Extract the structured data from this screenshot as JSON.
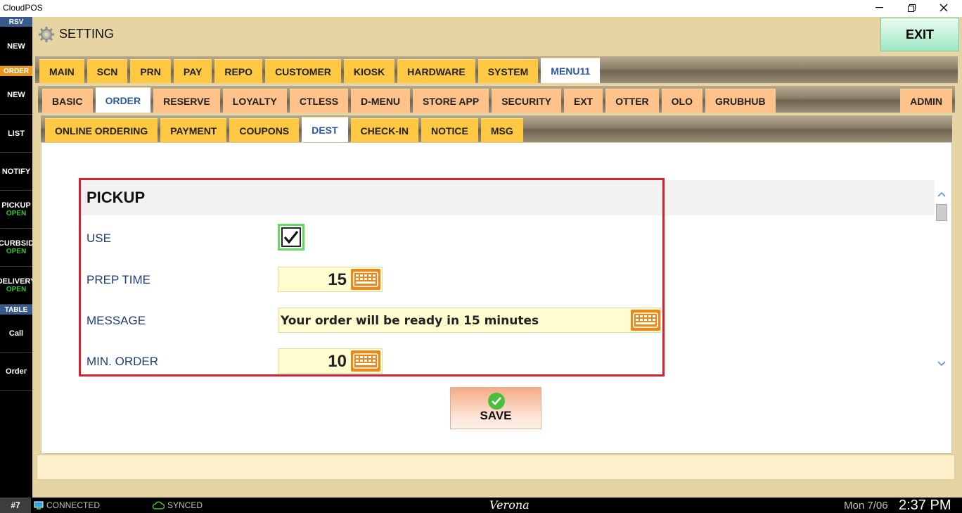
{
  "window": {
    "title": "CloudPOS",
    "minimize_icon": "minimize-icon",
    "maximize_icon": "restore-icon",
    "close_icon": "close-icon"
  },
  "sidebar": {
    "sections": [
      {
        "header": "RSV",
        "header_color": "#3a5a8c",
        "items": [
          {
            "label": "NEW",
            "sub": ""
          }
        ]
      },
      {
        "header": "ORDER",
        "header_color": "#e8951d",
        "items": [
          {
            "label": "NEW",
            "sub": ""
          },
          {
            "label": "LIST",
            "sub": ""
          },
          {
            "label": "NOTIFY",
            "sub": ""
          },
          {
            "label": "PICKUP",
            "sub": "OPEN"
          },
          {
            "label": "CURBSID",
            "sub": "OPEN"
          },
          {
            "label": "DELIVERY",
            "sub": "OPEN"
          }
        ]
      },
      {
        "header": "TABLE",
        "header_color": "#3a5a8c",
        "items": [
          {
            "label": "Call",
            "sub": ""
          },
          {
            "label": "Order",
            "sub": ""
          }
        ]
      }
    ]
  },
  "header": {
    "title": "SETTING",
    "icon": "gear-icon",
    "exit_label": "EXIT"
  },
  "tabs_level1": {
    "active": "MENU11",
    "items": [
      "MAIN",
      "SCN",
      "PRN",
      "PAY",
      "REPO",
      "CUSTOMER",
      "KIOSK",
      "HARDWARE",
      "SYSTEM",
      "MENU11"
    ]
  },
  "tabs_level2": {
    "active": "ORDER",
    "items": [
      "BASIC",
      "ORDER",
      "RESERVE",
      "LOYALTY",
      "CTLESS",
      "D-MENU",
      "STORE APP",
      "SECURITY",
      "EXT",
      "OTTER",
      "OLO",
      "GRUBHUB"
    ],
    "right_item": "ADMIN"
  },
  "tabs_level3": {
    "active": "DEST",
    "items": [
      "ONLINE ORDERING",
      "PAYMENT",
      "COUPONS",
      "DEST",
      "CHECK-IN",
      "NOTICE",
      "MSG"
    ]
  },
  "pickup": {
    "title": "PICKUP",
    "use_label": "USE",
    "use_checked": true,
    "prep_time_label": "PREP TIME",
    "prep_time_value": "15",
    "message_label": "MESSAGE",
    "message_value": "Your order will be ready in 15 minutes",
    "min_order_label": "MIN. ORDER",
    "min_order_value": "10",
    "keyboard_icon": "keyboard-icon"
  },
  "save": {
    "label": "SAVE",
    "icon": "check-circle-icon"
  },
  "status_bar": {
    "station": "#7",
    "connection": "CONNECTED",
    "sync": "SYNCED",
    "store_name": "Verona",
    "date": "Mon 7/06",
    "time": "2:37 PM"
  },
  "colors": {
    "tab_yellow": "#ffc843",
    "tab_peach": "#ffc28a",
    "frame": "#e6d5a2",
    "highlight_border": "#d6202f",
    "keyboard_orange": "#e8891d",
    "label_blue": "#1f3e77",
    "status_green": "#2fc82f"
  }
}
